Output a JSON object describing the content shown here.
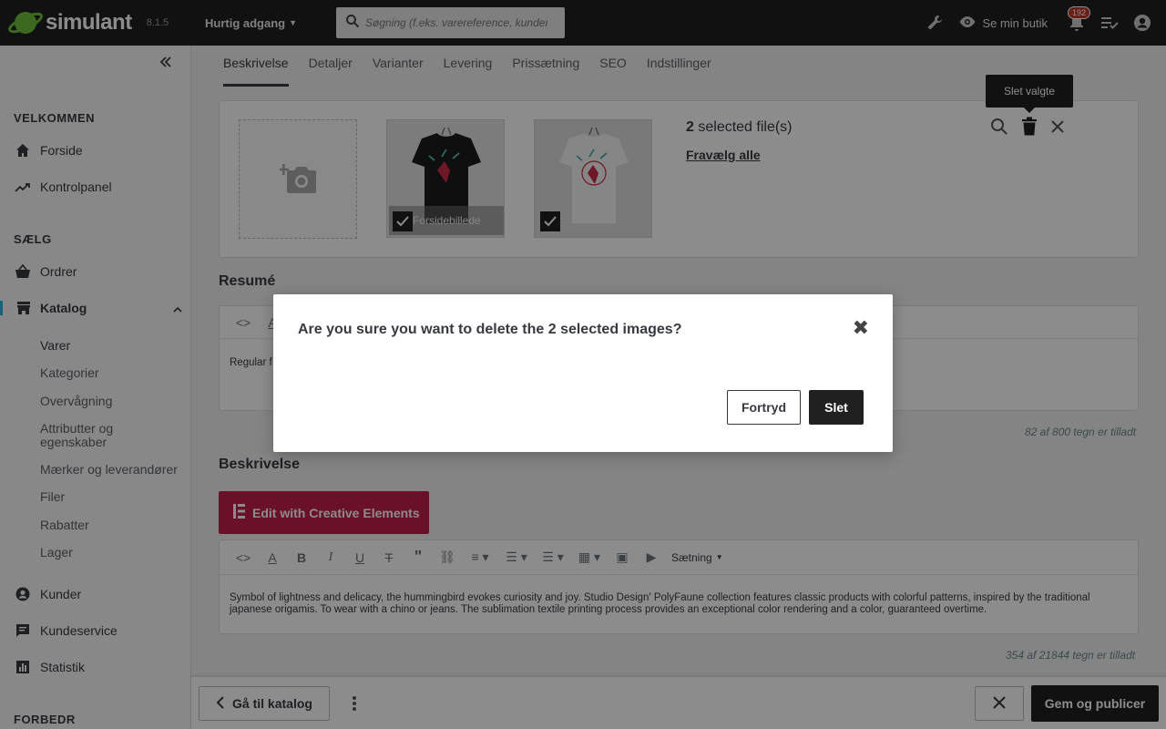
{
  "header": {
    "brand": "simulant",
    "version": "8.1.5",
    "quick_access": "Hurtig adgang",
    "search_placeholder": "Søgning (f.eks. varereference, kundenavn…)",
    "see_shop": "Se min butik",
    "notifications_count": "192"
  },
  "sidebar": {
    "sections": {
      "welcome": "VELKOMMEN",
      "sell": "SÆLG",
      "improve": "FORBEDR"
    },
    "items": {
      "home": "Forside",
      "dashboard": "Kontrolpanel",
      "orders": "Ordrer",
      "catalog": "Katalog",
      "customers": "Kunder",
      "service": "Kundeservice",
      "stats": "Statistik"
    },
    "catalog_sub": [
      "Varer",
      "Kategorier",
      "Overvågning",
      "Attributter og egenskaber",
      "Mærker og leverandører",
      "Filer",
      "Rabatter",
      "Lager"
    ]
  },
  "tabs": [
    "Beskrivelse",
    "Detaljer",
    "Varianter",
    "Levering",
    "Prissætning",
    "SEO",
    "Indstillinger"
  ],
  "images": {
    "selected_count": "2",
    "selected_text": "selected file(s)",
    "deselect_all": "Fravælg alle",
    "cover_label": "Forsidebillede",
    "tooltip": "Slet valgte"
  },
  "summary": {
    "label": "Resumé",
    "text": "Regular f",
    "counter": "82 af 800 tegn er tilladt"
  },
  "description": {
    "label": "Beskrivelse",
    "ce_button": "Edit with Creative Elements",
    "format_select": "Sætning",
    "text": "Symbol of lightness and delicacy, the hummingbird evokes curiosity and joy. Studio Design' PolyFaune collection features classic products with colorful patterns, inspired by the traditional japanese origamis. To wear with a chino or jeans. The sublimation textile printing process provides an exceptional color rendering and a color, guaranteed overtime.",
    "counter": "354 af 21844 tegn er tilladt"
  },
  "footer": {
    "back": "Gå til katalog",
    "save": "Gem og publicer"
  },
  "modal": {
    "title": "Are you sure you want to delete the 2 selected images?",
    "cancel": "Fortryd",
    "delete": "Slet"
  },
  "colors": {
    "header_bg": "#202020",
    "brand_green": "#6ec03b",
    "ce_button": "#c11e4b",
    "badge": "#c0392b"
  }
}
